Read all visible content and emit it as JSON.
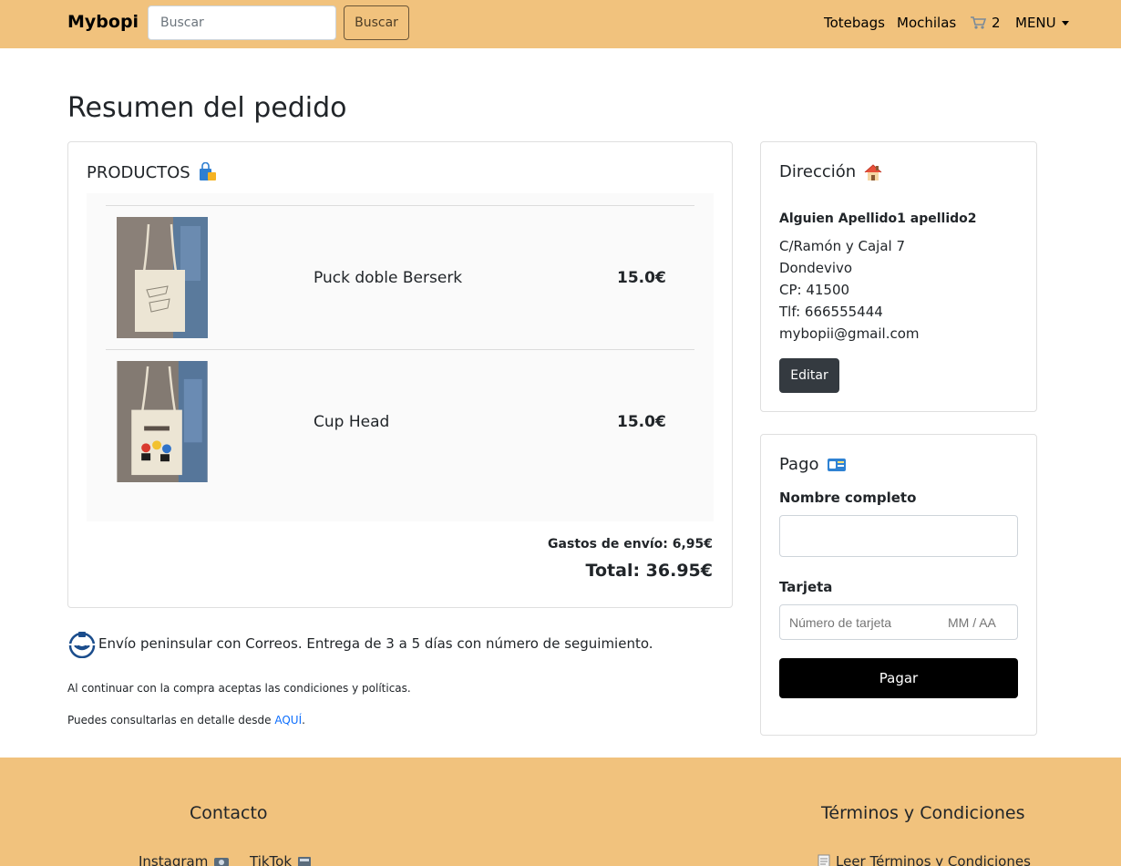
{
  "navbar": {
    "brand": "Mybopi",
    "search_placeholder": "Buscar",
    "search_button": "Buscar",
    "links": {
      "totebags": "Totebags",
      "mochilas": "Mochilas",
      "cart_count": "2",
      "menu": "MENU"
    },
    "background": "#f1c27d"
  },
  "page": {
    "title": "Resumen del pedido"
  },
  "products": {
    "heading": "PRODUCTOS",
    "heading_icon": "shopping-bags-icon",
    "items": [
      {
        "name": "Puck doble Berserk",
        "price": "15.0€",
        "image": "tote-bag-photo-berserk"
      },
      {
        "name": "Cup Head",
        "price": "15.0€",
        "image": "tote-bag-photo-cuphead"
      }
    ],
    "shipping": "Gastos de envío: 6,95€",
    "total": "Total: 36.95€"
  },
  "shipping_note": {
    "icon": "correos-logo-icon",
    "text": "Envío peninsular con Correos. Entrega de 3 a 5 días con número de seguimiento."
  },
  "legal": {
    "line1": "Al continuar con la compra aceptas las condiciones y políticas.",
    "line2_prefix": "Puedes consultarlas en detalle desde ",
    "line2_link": "AQUÍ",
    "line2_suffix": "."
  },
  "address": {
    "heading": "Dirección",
    "heading_icon": "house-icon",
    "name": "Alguien Apellido1 apellido2",
    "street": "C/Ramón y Cajal 7",
    "city": "Dondevivo",
    "cp": "CP: 41500",
    "phone": "Tlf: 666555444",
    "email": "mybopii@gmail.com",
    "edit_button": "Editar"
  },
  "payment": {
    "heading": "Pago",
    "heading_icon": "credit-card-icon",
    "name_label": "Nombre completo",
    "name_value": "",
    "card_label": "Tarjeta",
    "card_number_placeholder": "Número de tarjeta",
    "card_expiry_placeholder": "MM / AA",
    "pay_button": "Pagar"
  },
  "footer": {
    "contact_heading": "Contacto",
    "instagram": "Instagram",
    "tiktok": "TikTok",
    "terms_heading": "Términos y Condiciones",
    "terms_link": "Leer Términos y Condiciones"
  }
}
